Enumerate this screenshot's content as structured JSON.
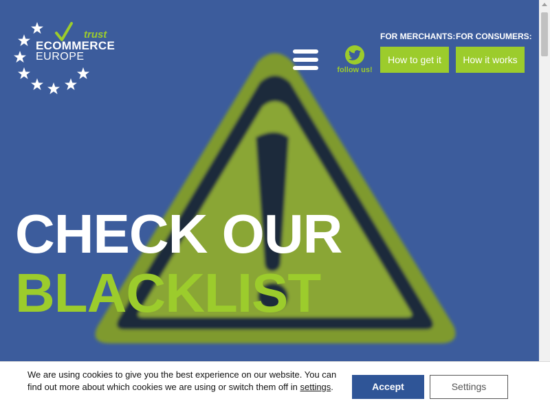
{
  "logo": {
    "trust": "trust",
    "line1": "ECOMMERCE",
    "line2": "EUROPE",
    "star_color": "#ffffff",
    "check_color": "#9ccc2c"
  },
  "header": {
    "menu_icon": "hamburger-icon",
    "follow": {
      "icon": "twitter-icon",
      "label": "follow us!"
    },
    "merchants": {
      "caption": "FOR MERCHANTS:",
      "button": "How to get it"
    },
    "consumers": {
      "caption": "FOR CONSUMERS:",
      "button": "How it works"
    }
  },
  "hero": {
    "line1": "CHECK OUR",
    "line2": "BLACKLIST",
    "image": "warning-sign"
  },
  "cookie": {
    "text_before": "We are using cookies to give you the best experience on our website. You can find out more about which cookies we are using or switch them off in",
    "link": "settings",
    "text_after": ".",
    "accept": "Accept",
    "settings": "Settings"
  },
  "colors": {
    "background": "#3c5c9c",
    "accent_green": "#9ccc2c",
    "accept_blue": "#2f5597"
  }
}
